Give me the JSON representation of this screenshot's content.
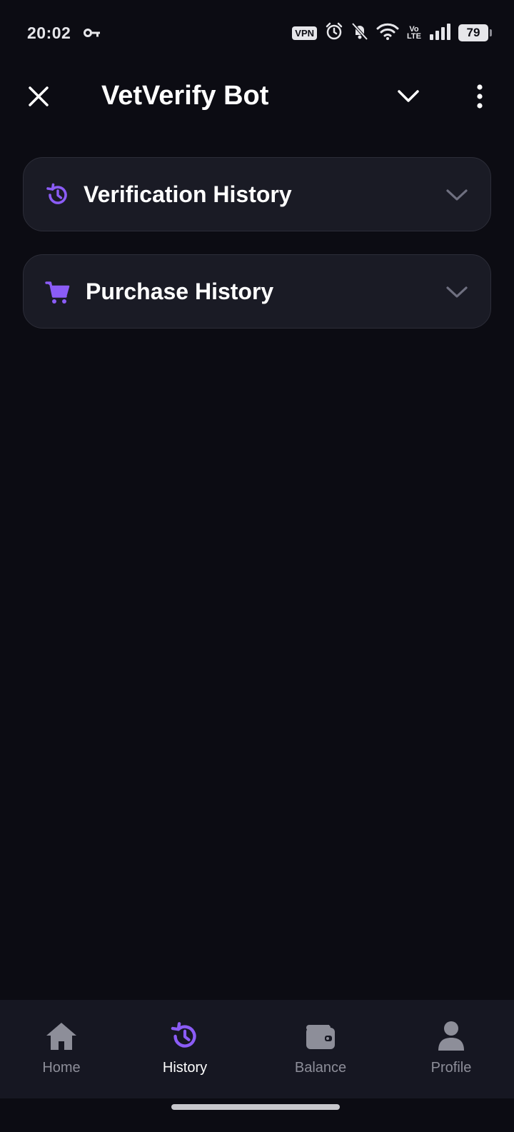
{
  "status_bar": {
    "time": "20:02",
    "vpn_label": "VPN",
    "volte_top": "Vo",
    "volte_bottom": "LTE",
    "battery_level": "79"
  },
  "header": {
    "title": "VetVerify Bot"
  },
  "sections": [
    {
      "label": "Verification History",
      "icon": "history-icon",
      "expanded": false
    },
    {
      "label": "Purchase History",
      "icon": "cart-icon",
      "expanded": false
    }
  ],
  "bottom_nav": {
    "items": [
      {
        "label": "Home",
        "icon": "home-icon",
        "active": false
      },
      {
        "label": "History",
        "icon": "history-icon",
        "active": true
      },
      {
        "label": "Balance",
        "icon": "wallet-icon",
        "active": false
      },
      {
        "label": "Profile",
        "icon": "person-icon",
        "active": false
      }
    ]
  },
  "colors": {
    "background": "#0c0c13",
    "card_background": "#1a1b25",
    "accent": "#8b5cf6",
    "nav_inactive": "#8d8e99"
  }
}
